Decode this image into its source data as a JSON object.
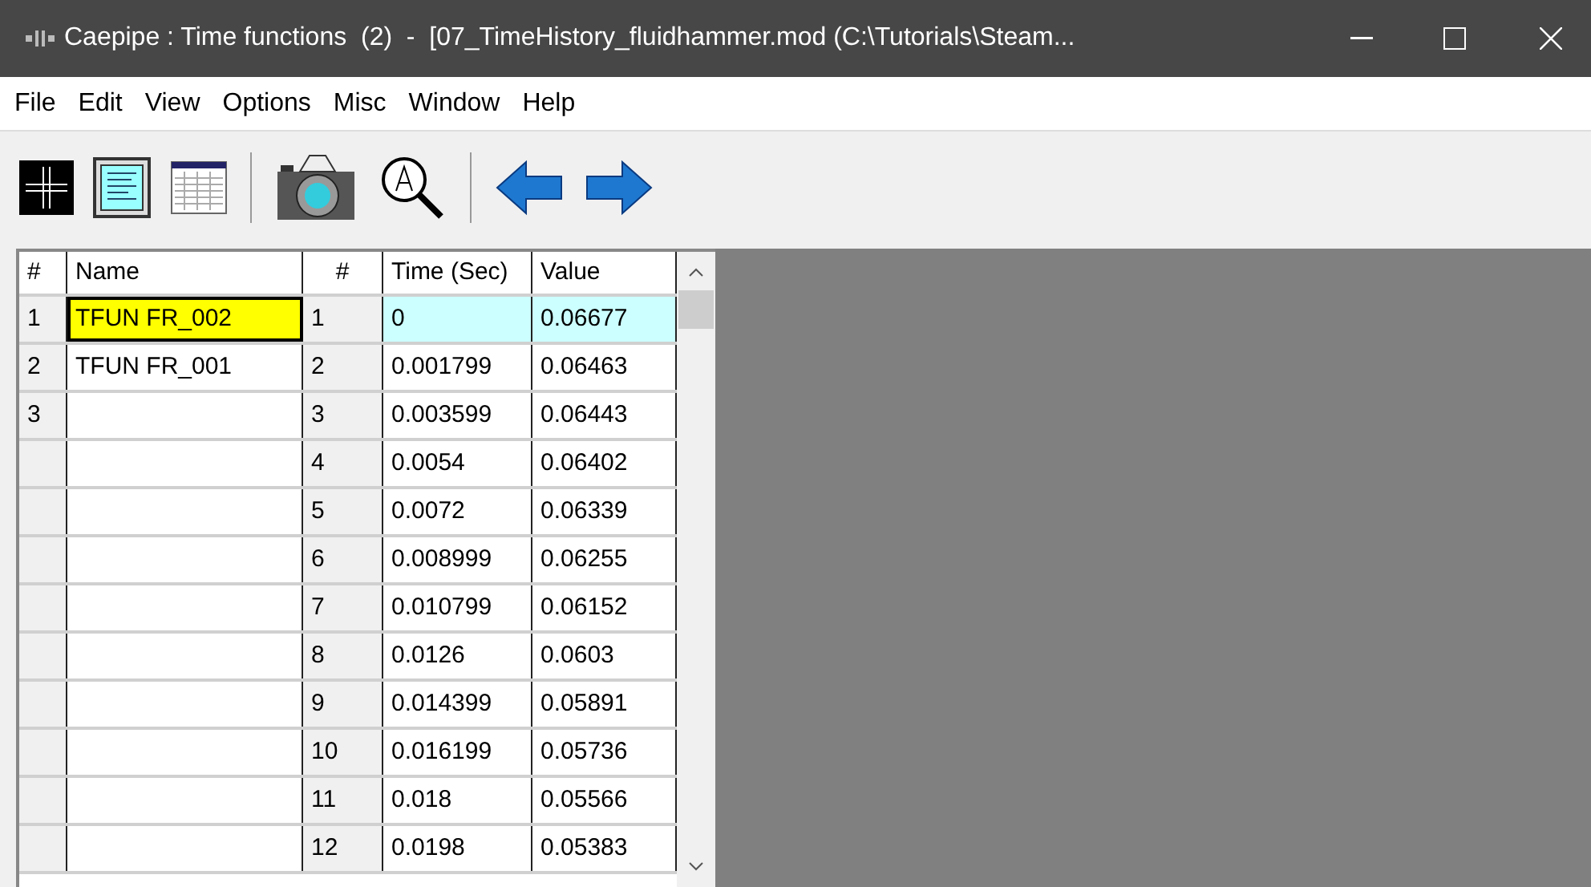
{
  "window": {
    "title": "Caepipe : Time functions  (2)  -  [07_TimeHistory_fluidhammer.mod (C:\\Tutorials\\Steam..."
  },
  "menu": [
    "File",
    "Edit",
    "View",
    "Options",
    "Misc",
    "Window",
    "Help"
  ],
  "functions": {
    "columns": [
      "#",
      "Name"
    ],
    "rows": [
      {
        "number": "1",
        "name": "TFUN FR_002",
        "selected": true
      },
      {
        "number": "2",
        "name": "TFUN FR_001",
        "selected": false
      },
      {
        "number": "3",
        "selected": false
      }
    ]
  },
  "points": {
    "columns": [
      "#",
      "Time (Sec)",
      "Value"
    ],
    "rows": [
      {
        "number": "1",
        "time": "0",
        "value": "0.06677",
        "selected": true
      },
      {
        "number": "2",
        "time": "0.001799",
        "value": "0.06463",
        "selected": false
      },
      {
        "number": "3",
        "time": "0.003599",
        "value": "0.06443",
        "selected": false
      },
      {
        "number": "4",
        "time": "0.0054",
        "value": "0.06402",
        "selected": false
      },
      {
        "number": "5",
        "time": "0.0072",
        "value": "0.06339",
        "selected": false
      },
      {
        "number": "6",
        "time": "0.008999",
        "value": "0.06255",
        "selected": false
      },
      {
        "number": "7",
        "time": "0.010799",
        "value": "0.06152",
        "selected": false
      },
      {
        "number": "8",
        "time": "0.0126",
        "value": "0.0603",
        "selected": false
      },
      {
        "number": "9",
        "time": "0.014399",
        "value": "0.05891",
        "selected": false
      },
      {
        "number": "10",
        "time": "0.016199",
        "value": "0.05736",
        "selected": false
      },
      {
        "number": "11",
        "time": "0.018",
        "value": "0.05566",
        "selected": false
      },
      {
        "number": "12",
        "time": "0.0198",
        "value": "0.05383",
        "selected": false
      }
    ]
  }
}
